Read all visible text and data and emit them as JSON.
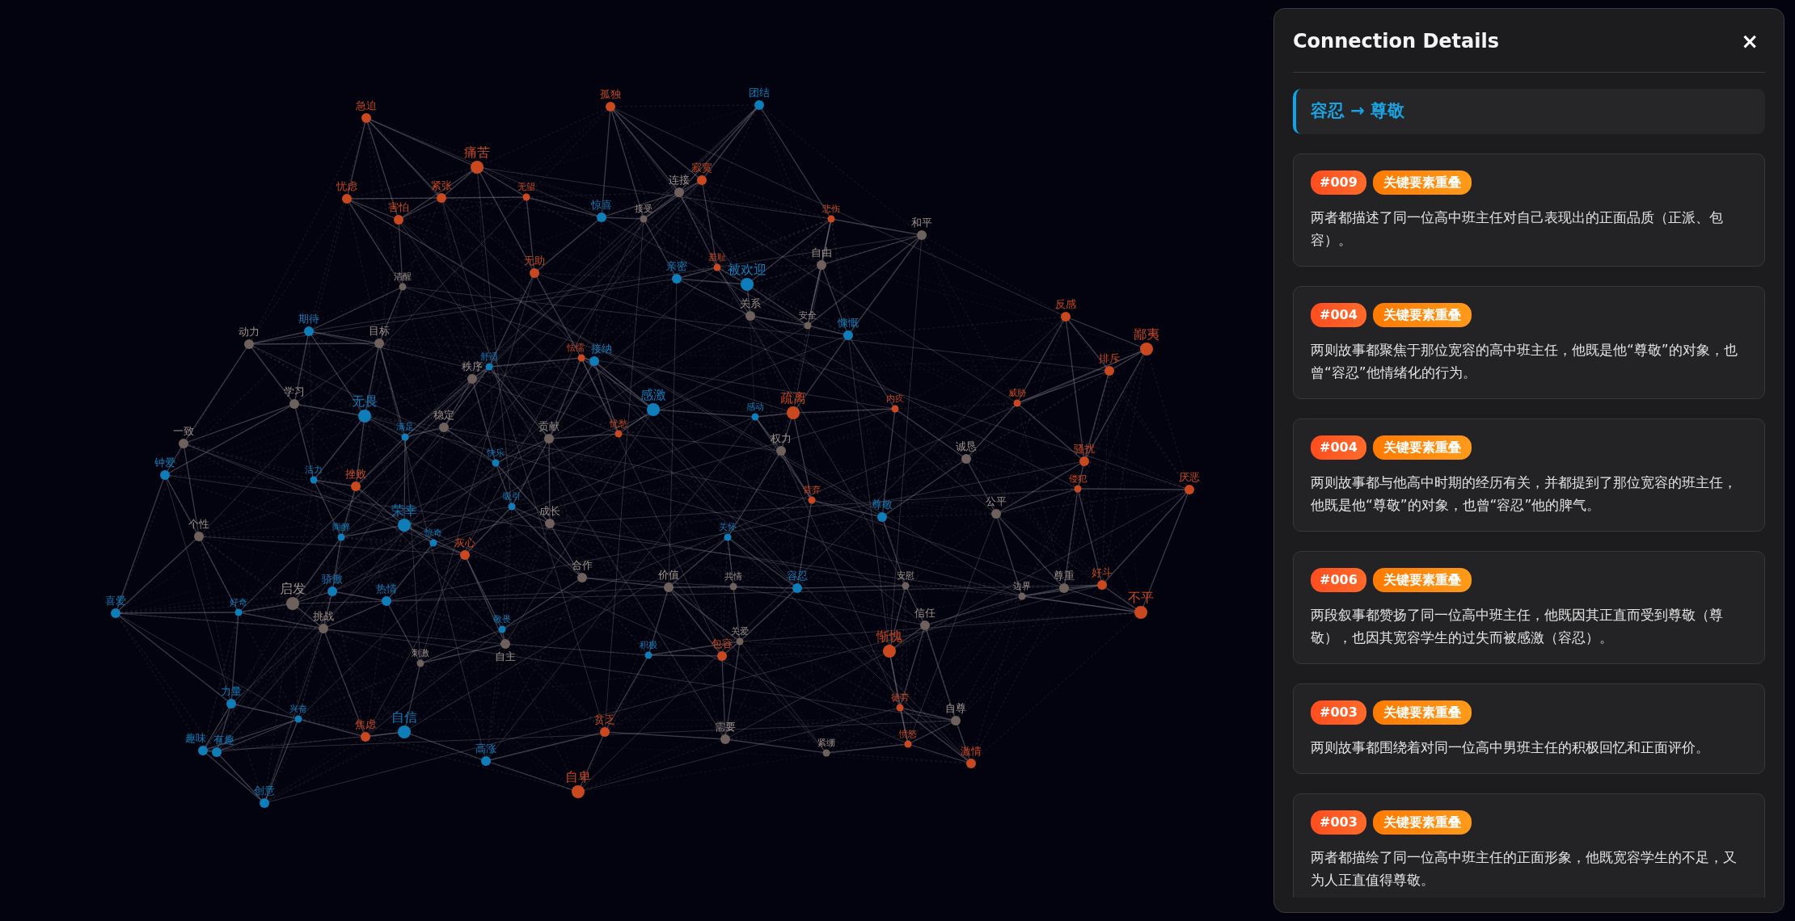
{
  "graph": {
    "nodes": [
      {
        "label": "急迫",
        "color": "#c9481f"
      },
      {
        "label": "孤独",
        "color": "#c9481f"
      },
      {
        "label": "团结",
        "color": "#0f7db8"
      },
      {
        "label": "痛苦",
        "color": "#c9481f"
      },
      {
        "label": "忧虑",
        "color": "#c9481f"
      },
      {
        "label": "紧张",
        "color": "#c9481f"
      },
      {
        "label": "无望",
        "color": "#c9481f"
      },
      {
        "label": "惊喜",
        "color": "#0f7db8"
      },
      {
        "label": "连接",
        "color": "#6e615b"
      },
      {
        "label": "寂寞",
        "color": "#c9481f"
      },
      {
        "label": "害怕",
        "color": "#c9481f"
      },
      {
        "label": "接受",
        "color": "#6e615b"
      },
      {
        "label": "悲伤",
        "color": "#c9481f"
      },
      {
        "label": "和平",
        "color": "#6e615b"
      },
      {
        "label": "清醒",
        "color": "#6e615b"
      },
      {
        "label": "无助",
        "color": "#c9481f"
      },
      {
        "label": "亲密",
        "color": "#0f7db8"
      },
      {
        "label": "羞耻",
        "color": "#c9481f"
      },
      {
        "label": "被欢迎",
        "color": "#0f7db8"
      },
      {
        "label": "自由",
        "color": "#6e615b"
      },
      {
        "label": "期待",
        "color": "#0f7db8"
      },
      {
        "label": "关系",
        "color": "#6e615b"
      },
      {
        "label": "安全",
        "color": "#6e615b"
      },
      {
        "label": "慷慨",
        "color": "#0f7db8"
      },
      {
        "label": "反感",
        "color": "#c9481f"
      },
      {
        "label": "动力",
        "color": "#6e615b"
      },
      {
        "label": "目标",
        "color": "#6e615b"
      },
      {
        "label": "秩序",
        "color": "#6e615b"
      },
      {
        "label": "舒适",
        "color": "#0f7db8"
      },
      {
        "label": "怯懦",
        "color": "#c9481f"
      },
      {
        "label": "接纳",
        "color": "#0f7db8"
      },
      {
        "label": "排斥",
        "color": "#c9481f"
      },
      {
        "label": "鄙夷",
        "color": "#c9481f"
      },
      {
        "label": "学习",
        "color": "#6e615b"
      },
      {
        "label": "无畏",
        "color": "#0f7db8"
      },
      {
        "label": "感激",
        "color": "#0f7db8"
      },
      {
        "label": "感动",
        "color": "#0f7db8"
      },
      {
        "label": "疏离",
        "color": "#c9481f"
      },
      {
        "label": "内疚",
        "color": "#c9481f"
      },
      {
        "label": "威胁",
        "color": "#c9481f"
      },
      {
        "label": "一致",
        "color": "#6e615b"
      },
      {
        "label": "满足",
        "color": "#0f7db8"
      },
      {
        "label": "稳定",
        "color": "#6e615b"
      },
      {
        "label": "贡献",
        "color": "#6e615b"
      },
      {
        "label": "忧愁",
        "color": "#c9481f"
      },
      {
        "label": "权力",
        "color": "#6e615b"
      },
      {
        "label": "诚恳",
        "color": "#6e615b"
      },
      {
        "label": "钟爱",
        "color": "#0f7db8"
      },
      {
        "label": "活力",
        "color": "#0f7db8"
      },
      {
        "label": "挫败",
        "color": "#c9481f"
      },
      {
        "label": "快乐",
        "color": "#0f7db8"
      },
      {
        "label": "背弃",
        "color": "#c9481f"
      },
      {
        "label": "侵犯",
        "color": "#c9481f"
      },
      {
        "label": "骚扰",
        "color": "#c9481f"
      },
      {
        "label": "厌恶",
        "color": "#c9481f"
      },
      {
        "label": "个性",
        "color": "#6e615b"
      },
      {
        "label": "陶醉",
        "color": "#0f7db8"
      },
      {
        "label": "荣幸",
        "color": "#0f7db8"
      },
      {
        "label": "吸引",
        "color": "#0f7db8"
      },
      {
        "label": "成长",
        "color": "#6e615b"
      },
      {
        "label": "关怀",
        "color": "#0f7db8"
      },
      {
        "label": "尊敬",
        "color": "#0f7db8"
      },
      {
        "label": "公平",
        "color": "#6e615b"
      },
      {
        "label": "惊奇",
        "color": "#0f7db8"
      },
      {
        "label": "灰心",
        "color": "#c9481f"
      },
      {
        "label": "合作",
        "color": "#6e615b"
      },
      {
        "label": "喜爱",
        "color": "#0f7db8"
      },
      {
        "label": "好奇",
        "color": "#0f7db8"
      },
      {
        "label": "启发",
        "color": "#6e615b"
      },
      {
        "label": "骄傲",
        "color": "#0f7db8"
      },
      {
        "label": "热情",
        "color": "#0f7db8"
      },
      {
        "label": "价值",
        "color": "#6e615b"
      },
      {
        "label": "共情",
        "color": "#6e615b"
      },
      {
        "label": "容忍",
        "color": "#0f7db8"
      },
      {
        "label": "安慰",
        "color": "#6e615b"
      },
      {
        "label": "边界",
        "color": "#6e615b"
      },
      {
        "label": "尊重",
        "color": "#6e615b"
      },
      {
        "label": "好斗",
        "color": "#c9481f"
      },
      {
        "label": "不平",
        "color": "#c9481f"
      },
      {
        "label": "挑战",
        "color": "#6e615b"
      },
      {
        "label": "刺激",
        "color": "#6e615b"
      },
      {
        "label": "敬畏",
        "color": "#0f7db8"
      },
      {
        "label": "自主",
        "color": "#6e615b"
      },
      {
        "label": "积极",
        "color": "#0f7db8"
      },
      {
        "label": "包容",
        "color": "#c9481f"
      },
      {
        "label": "关爱",
        "color": "#6e615b"
      },
      {
        "label": "惭愧",
        "color": "#c9481f"
      },
      {
        "label": "信任",
        "color": "#6e615b"
      },
      {
        "label": "力量",
        "color": "#0f7db8"
      },
      {
        "label": "兴奋",
        "color": "#0f7db8"
      },
      {
        "label": "焦虑",
        "color": "#c9481f"
      },
      {
        "label": "自信",
        "color": "#0f7db8"
      },
      {
        "label": "贫乏",
        "color": "#c9481f"
      },
      {
        "label": "需要",
        "color": "#6e615b"
      },
      {
        "label": "徒劳",
        "color": "#c9481f"
      },
      {
        "label": "愤怒",
        "color": "#c9481f"
      },
      {
        "label": "自尊",
        "color": "#6e615b"
      },
      {
        "label": "趣味",
        "color": "#0f7db8"
      },
      {
        "label": "有趣",
        "color": "#0f7db8"
      },
      {
        "label": "高涨",
        "color": "#0f7db8"
      },
      {
        "label": "紧绷",
        "color": "#6e615b"
      },
      {
        "label": "激情",
        "color": "#c9481f"
      },
      {
        "label": "创意",
        "color": "#0f7db8"
      },
      {
        "label": "自卑",
        "color": "#c9481f"
      }
    ]
  },
  "panel": {
    "title": "Connection Details",
    "close": "×",
    "connection": "容忍 → 尊敬",
    "matches": [
      {
        "id": "#009",
        "tag": "关键要素重叠",
        "text": "两者都描述了同一位高中班主任对自己表现出的正面品质（正派、包容）。"
      },
      {
        "id": "#004",
        "tag": "关键要素重叠",
        "text": "两则故事都聚焦于那位宽容的高中班主任，他既是他“尊敬”的对象，也曾“容忍”他情绪化的行为。"
      },
      {
        "id": "#004",
        "tag": "关键要素重叠",
        "text": "两则故事都与他高中时期的经历有关，并都提到了那位宽容的班主任，他既是他“尊敬”的对象，也曾“容忍”他的脾气。"
      },
      {
        "id": "#006",
        "tag": "关键要素重叠",
        "text": "两段叙事都赞扬了同一位高中班主任，他既因其正直而受到尊敬（尊敬），也因其宽容学生的过失而被感激（容忍）。"
      },
      {
        "id": "#003",
        "tag": "关键要素重叠",
        "text": "两则故事都围绕着对同一位高中男班主任的积极回忆和正面评价。"
      },
      {
        "id": "#003",
        "tag": "关键要素重叠",
        "text": "两者都描绘了同一位高中班主任的正面形象，他既宽容学生的不足，又为人正直值得尊敬。"
      }
    ]
  }
}
